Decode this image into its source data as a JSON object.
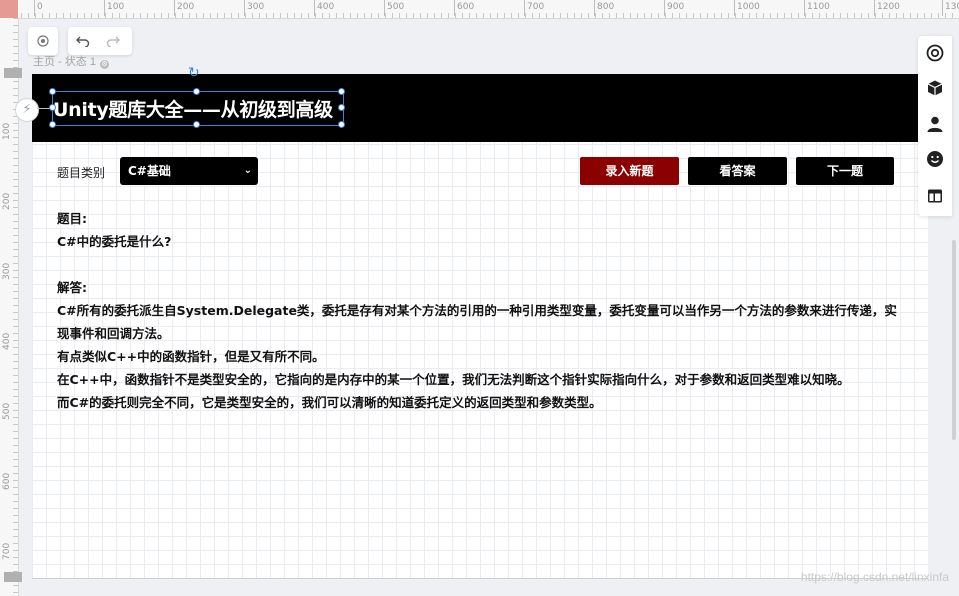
{
  "ruler": {
    "top_ticks": [
      "0",
      "100",
      "200",
      "300",
      "400",
      "500",
      "600",
      "700",
      "800",
      "900",
      "1000",
      "1100",
      "1200",
      "130"
    ],
    "left_ticks": [
      "100",
      "200",
      "300",
      "400",
      "500",
      "600",
      "700"
    ]
  },
  "page_state_label": "主页 - 状态 1",
  "toolbar": {
    "target_icon": "target-icon",
    "undo_icon": "undo-icon",
    "redo_icon": "redo-icon"
  },
  "header": {
    "title": "Unity题库大全——从初级到高级",
    "background": "#000000"
  },
  "controls": {
    "category_label": "题目类别",
    "category_selected": "C#基础",
    "buttons": {
      "add_question": "录入新题",
      "show_answer": "看答案",
      "next_question": "下一题"
    },
    "add_question_color": "#8b0000"
  },
  "qa": {
    "question_heading": "题目:",
    "question_text": "C#中的委托是什么?",
    "answer_heading": "解答:",
    "answer_lines": [
      "C#所有的委托派生自System.Delegate类，委托是存有对某个方法的引用的一种引用类型变量，委托变量可以当作另一个方法的参数来进行传递，实现事件和回调方法。",
      "有点类似C++中的函数指针，但是又有所不同。",
      "在C++中，函数指针不是类型安全的，它指向的是内存中的某一个位置，我们无法判断这个指针实际指向什么，对于参数和返回类型难以知晓。",
      "而C#的委托则完全不同，它是类型安全的，我们可以清晰的知道委托定义的返回类型和参数类型。"
    ]
  },
  "right_panel": {
    "icons": [
      "target-icon",
      "cube-icon",
      "user-icon",
      "smile-icon",
      "layout-icon"
    ]
  },
  "watermark": "https://blog.csdn.net/linxinfa"
}
